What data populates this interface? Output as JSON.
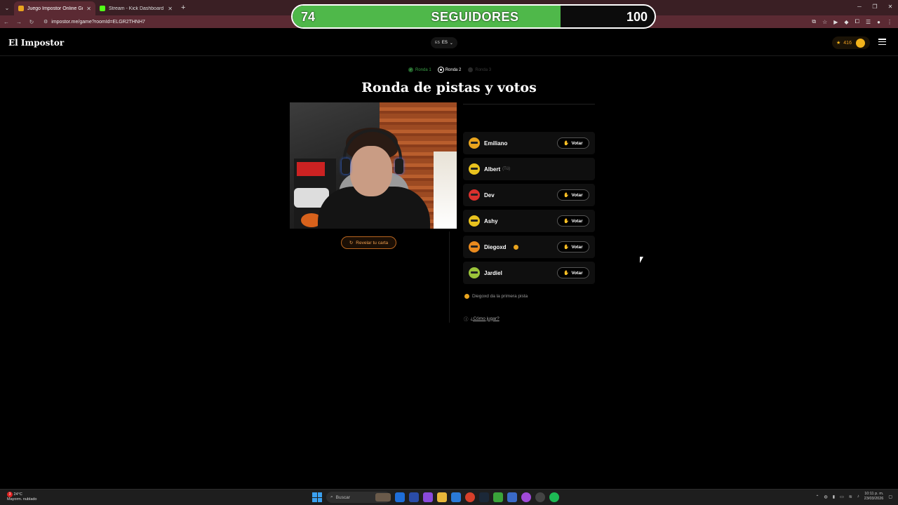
{
  "browser": {
    "tabs": [
      {
        "title": "Juego Impostor Online Gratis",
        "active": true,
        "fav_color": "#e9a41e"
      },
      {
        "title": "Stream - Kick Dashboard",
        "active": false,
        "fav_color": "#53fc18"
      }
    ],
    "url": "impostor.me/game?roomId=ELGR2THNH7"
  },
  "followers_goal": {
    "current": "74",
    "label": "SEGUIDORES",
    "goal": "100",
    "progress": 0.74,
    "accent": "#4fb84a"
  },
  "header": {
    "logo": "El Impostor",
    "lang_flag": "ES",
    "lang": "ES",
    "coins": "416"
  },
  "steps": [
    {
      "label": "Ronda 1",
      "state": "done"
    },
    {
      "label": "Ronda 2",
      "state": "current"
    },
    {
      "label": "Ronda 3",
      "state": "pending"
    }
  ],
  "title": "Ronda de pistas y votos",
  "reveal_button": "Revelar tu carta",
  "players": [
    {
      "name": "Emiliano",
      "tag": "",
      "vote": "Votar",
      "avatar": "#e9a41e",
      "turn": false
    },
    {
      "name": "Albert",
      "tag": "(Tú)",
      "vote": "",
      "avatar": "#e9c21e",
      "turn": false
    },
    {
      "name": "Dev",
      "tag": "",
      "vote": "Votar",
      "avatar": "#d8312e",
      "turn": false
    },
    {
      "name": "Ashy",
      "tag": "",
      "vote": "Votar",
      "avatar": "#e9c21e",
      "turn": false
    },
    {
      "name": "Diegoxd",
      "tag": "",
      "vote": "Votar",
      "avatar": "#e98a1e",
      "turn": true
    },
    {
      "name": "Jardiel",
      "tag": "",
      "vote": "Votar",
      "avatar": "#9bc43a",
      "turn": false
    }
  ],
  "hint": "Diegoxd da la primera pista",
  "howto": "¿Cómo jugar?",
  "taskbar": {
    "weather_badge": "3",
    "weather_temp": "24°C",
    "weather_desc": "Mayorm. nublado",
    "search": "Buscar",
    "time": "10:11 p. m.",
    "date": "23/03/2026"
  }
}
